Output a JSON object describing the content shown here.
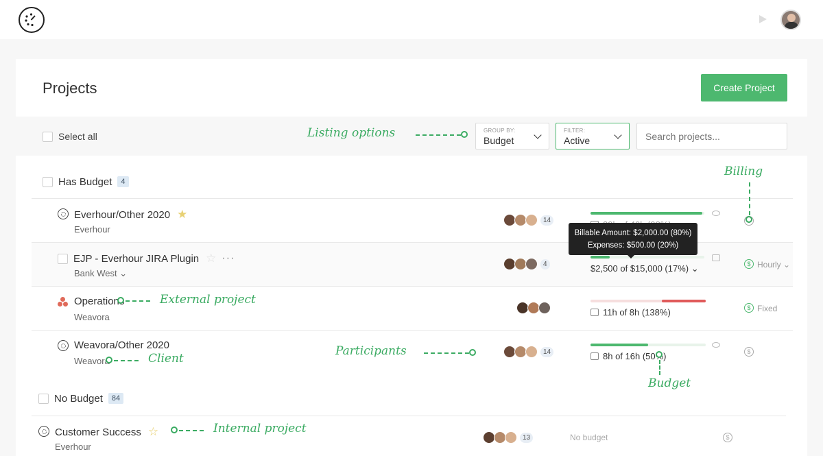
{
  "header": {
    "title": "Projects",
    "create_button": "Create Project"
  },
  "toolbar": {
    "select_all": "Select all",
    "group_by_caption": "GROUP BY:",
    "group_by_value": "Budget",
    "filter_caption": "FILTER:",
    "filter_value": "Active",
    "search_placeholder": "Search projects..."
  },
  "groups": {
    "has_budget": {
      "label": "Has Budget",
      "count": "4"
    },
    "no_budget": {
      "label": "No Budget",
      "count": "84"
    }
  },
  "projects": [
    {
      "name": "Everhour/Other 2020",
      "client": "Everhour",
      "participants_count": "14",
      "budget_text": "39h of 40h (98%)",
      "budget_progress": 0.98
    },
    {
      "name": "EJP - Everhour JIRA Plugin",
      "client": "Bank West",
      "participants_count": "4",
      "budget_text": "$2,500 of $15,000 (17%)",
      "budget_progress": 0.17,
      "billing": "Hourly"
    },
    {
      "name": "Operations",
      "client": "Weavora",
      "budget_text": "11h of 8h (138%)",
      "budget_progress": 1.38,
      "billing": "Fixed"
    },
    {
      "name": "Weavora/Other 2020",
      "client": "Weavora",
      "participants_count": "14",
      "budget_text": "8h of 16h (50%)",
      "budget_progress": 0.5
    },
    {
      "name": "Customer Success",
      "client": "Everhour",
      "participants_count": "13",
      "budget_text": "No budget"
    }
  ],
  "tooltip": {
    "line1": "Billable Amount: $2,000.00 (80%)",
    "line2": "Expenses: $500.00 (20%)"
  },
  "annotations": {
    "listing": "Listing options",
    "billing": "Billing",
    "external": "External project",
    "participants": "Participants",
    "client": "Client",
    "budget": "Budget",
    "internal": "Internal project"
  },
  "icons": {
    "logo": "clock-logo-icon",
    "billing": "dollar-icon",
    "budget": "calendar-icon"
  },
  "colors": {
    "accent": "#4db86f",
    "over_budget": "#e05a5a",
    "external_icon": "#e06a5a"
  }
}
